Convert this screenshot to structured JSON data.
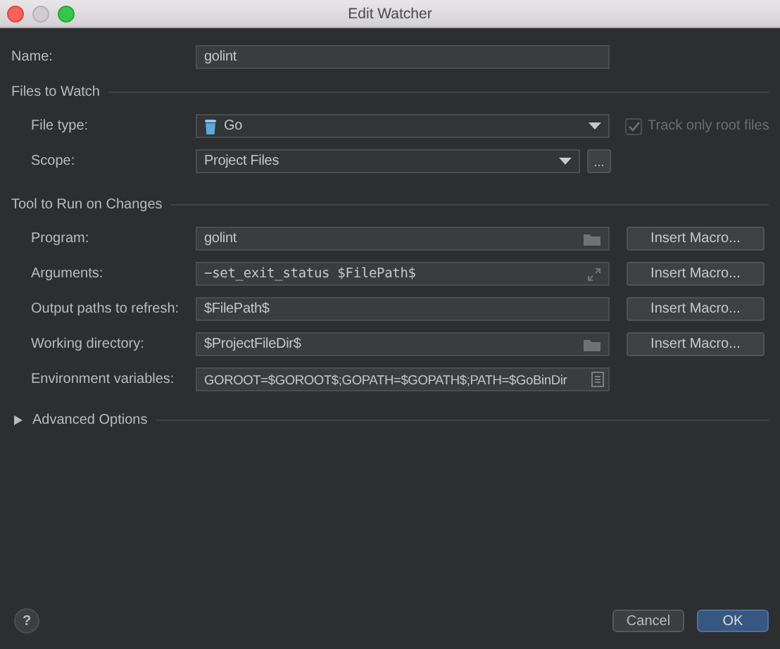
{
  "window": {
    "title": "Edit Watcher"
  },
  "name": {
    "label": "Name:",
    "value": "golint"
  },
  "files_to_watch": {
    "title": "Files to Watch",
    "file_type": {
      "label": "File type:",
      "value": "Go"
    },
    "track_only_root_files": {
      "label": "Track only root files",
      "checked": true,
      "disabled": true
    },
    "scope": {
      "label": "Scope:",
      "value": "Project Files",
      "more_button": "..."
    }
  },
  "tool_to_run": {
    "title": "Tool to Run on Changes",
    "fields": [
      {
        "label": "Program:",
        "value": "golint",
        "kind": "folder",
        "macro_button": "Insert Macro..."
      },
      {
        "label": "Arguments:",
        "value": "−set_exit_status $FilePath$",
        "kind": "expand",
        "macro_button": "Insert Macro..."
      },
      {
        "label": "Output paths to refresh:",
        "value": "$FilePath$",
        "kind": "plain",
        "macro_button": "Insert Macro..."
      },
      {
        "label": "Working directory:",
        "value": "$ProjectFileDir$",
        "kind": "folder",
        "macro_button": "Insert Macro..."
      },
      {
        "label": "Environment variables:",
        "value": "GOROOT=$GOROOT$;GOPATH=$GOPATH$;PATH=$GoBinDir",
        "kind": "env"
      }
    ]
  },
  "advanced_options": {
    "label": "Advanced Options",
    "expanded": false
  },
  "help": "?",
  "buttons": [
    {
      "label": "Cancel",
      "default": false
    },
    {
      "label": "OK",
      "default": true
    }
  ]
}
